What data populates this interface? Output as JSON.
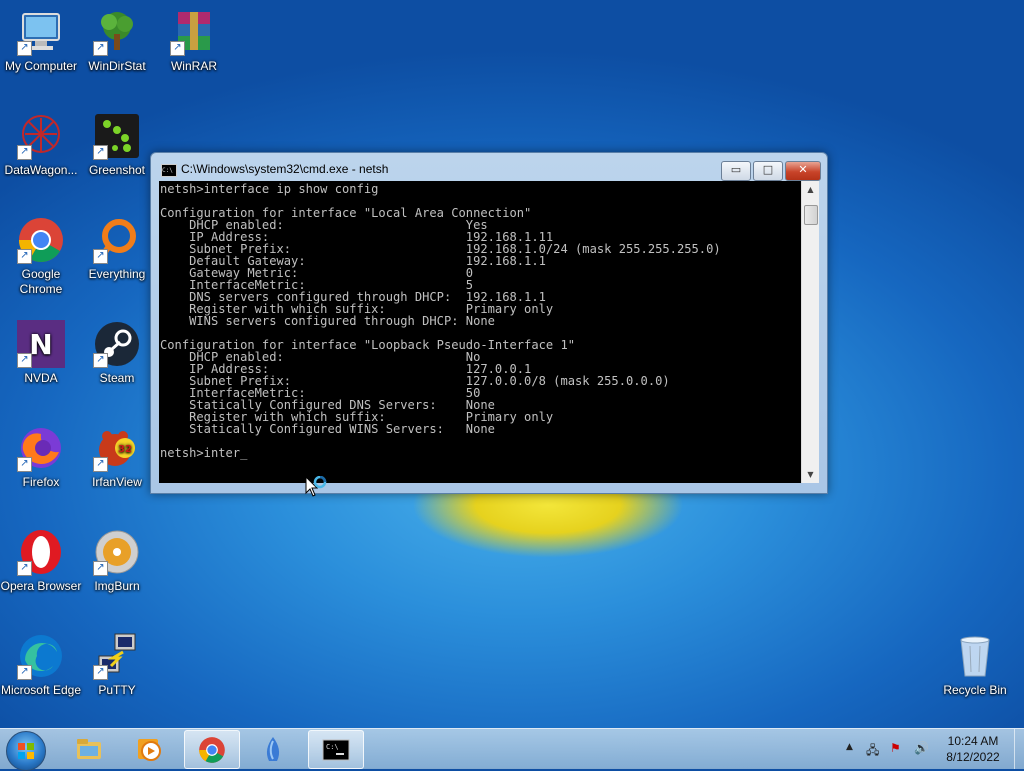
{
  "desktop": {
    "icons": [
      {
        "label": "My Computer",
        "icon": "computer-icon"
      },
      {
        "label": "WinDirStat",
        "icon": "windirstat-icon"
      },
      {
        "label": "WinRAR",
        "icon": "winrar-icon"
      },
      {
        "label": "DataWagon...",
        "icon": "datawagon-icon"
      },
      {
        "label": "Greenshot",
        "icon": "greenshot-icon"
      },
      {
        "label": "Google Chrome",
        "icon": "chrome-icon"
      },
      {
        "label": "Everything",
        "icon": "everything-icon"
      },
      {
        "label": "NVDA",
        "icon": "nvda-icon"
      },
      {
        "label": "Steam",
        "icon": "steam-icon"
      },
      {
        "label": "Firefox",
        "icon": "firefox-icon"
      },
      {
        "label": "IrfanView",
        "icon": "irfanview-icon"
      },
      {
        "label": "Opera Browser",
        "icon": "opera-icon"
      },
      {
        "label": "ImgBurn",
        "icon": "imgburn-icon"
      },
      {
        "label": "Microsoft Edge",
        "icon": "edge-icon"
      },
      {
        "label": "PuTTY",
        "icon": "putty-icon"
      },
      {
        "label": "Recycle Bin",
        "icon": "recycle-bin-icon"
      }
    ]
  },
  "cmd_window": {
    "title": "C:\\Windows\\system32\\cmd.exe - netsh",
    "controls": {
      "minimize": "▭",
      "maximize": "□",
      "close": "✕"
    },
    "console_lines": [
      "netsh>interface ip show config",
      "",
      "Configuration for interface \"Local Area Connection\"",
      "    DHCP enabled:                         Yes",
      "    IP Address:                           192.168.1.11",
      "    Subnet Prefix:                        192.168.1.0/24 (mask 255.255.255.0)",
      "    Default Gateway:                      192.168.1.1",
      "    Gateway Metric:                       0",
      "    InterfaceMetric:                      5",
      "    DNS servers configured through DHCP:  192.168.1.1",
      "    Register with which suffix:           Primary only",
      "    WINS servers configured through DHCP: None",
      "",
      "Configuration for interface \"Loopback Pseudo-Interface 1\"",
      "    DHCP enabled:                         No",
      "    IP Address:                           127.0.0.1",
      "    Subnet Prefix:                        127.0.0.0/8 (mask 255.0.0.0)",
      "    InterfaceMetric:                      50",
      "    Statically Configured DNS Servers:    None",
      "    Register with which suffix:           Primary only",
      "    Statically Configured WINS Servers:   None",
      ""
    ],
    "prompt": "netsh>",
    "input": "inter"
  },
  "taskbar": {
    "items": [
      {
        "icon": "file-explorer-icon"
      },
      {
        "icon": "media-player-icon"
      },
      {
        "icon": "chrome-icon"
      },
      {
        "icon": "app-icon"
      },
      {
        "icon": "cmd-icon"
      }
    ],
    "clock_time": "10:24 AM",
    "clock_date": "8/12/2022"
  },
  "colors": {
    "console_bg": "#000000",
    "console_fg": "#c0c0c0",
    "close_button": "#c8442a"
  }
}
